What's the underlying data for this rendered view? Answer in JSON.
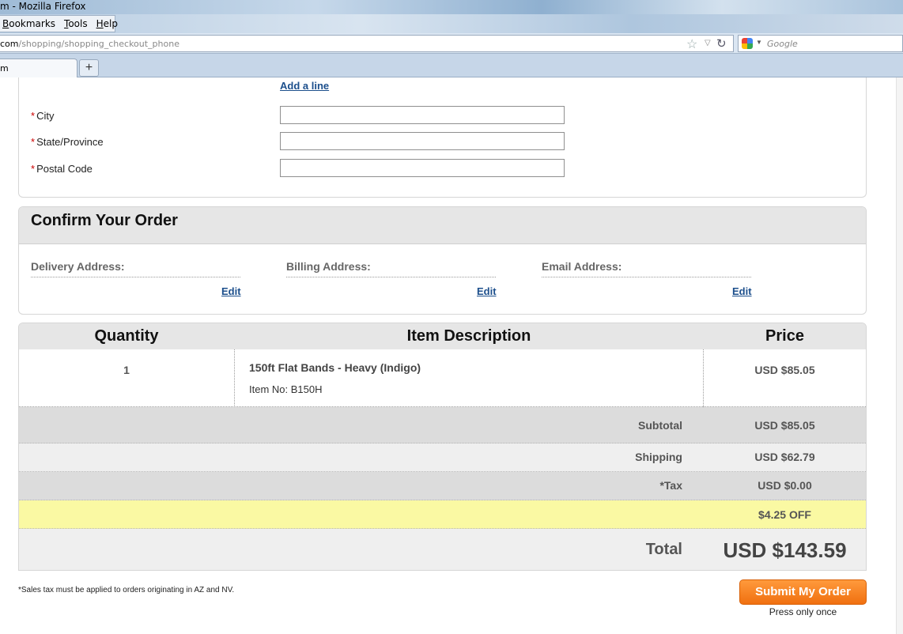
{
  "window": {
    "title": "m - Mozilla Firefox"
  },
  "menu": [
    {
      "label": "Bookmarks",
      "u": "B",
      "rest": "ookmarks"
    },
    {
      "label": "Tools",
      "u": "T",
      "rest": "ools"
    },
    {
      "label": "Help",
      "u": "H",
      "rest": "elp"
    }
  ],
  "address_bar": {
    "domain": "com",
    "path": "/shopping/shopping_checkout_phone"
  },
  "search_bar": {
    "placeholder": "Google"
  },
  "tab": {
    "label": "m",
    "new_tab_label": "+"
  },
  "form": {
    "add_line": "Add a line",
    "required_mark": "*",
    "fields": [
      {
        "label": "City",
        "value": ""
      },
      {
        "label": "State/Province",
        "value": ""
      },
      {
        "label": "Postal Code",
        "value": ""
      }
    ]
  },
  "confirm": {
    "title": "Confirm Your Order",
    "columns": [
      {
        "label": "Delivery Address:",
        "edit": "Edit"
      },
      {
        "label": "Billing Address:",
        "edit": "Edit"
      },
      {
        "label": "Email Address:",
        "edit": "Edit"
      }
    ]
  },
  "order": {
    "headers": {
      "quantity": "Quantity",
      "description": "Item Description",
      "price": "Price"
    },
    "items": [
      {
        "quantity": "1",
        "name": "150ft Flat Bands - Heavy (Indigo)",
        "item_no": "Item No: B150H",
        "price": "USD $85.05"
      }
    ],
    "subtotal": {
      "label": "Subtotal",
      "value": "USD $85.05"
    },
    "shipping": {
      "label": "Shipping",
      "value": "USD $62.79"
    },
    "tax": {
      "label": "*Tax",
      "value": "USD $0.00"
    },
    "discount": {
      "value": "$4.25 OFF"
    },
    "total": {
      "label": "Total",
      "value": "USD $143.59"
    }
  },
  "footer": {
    "tax_note": "*Sales tax must be applied to orders originating in AZ and NV.",
    "submit_label": "Submit My Order",
    "submit_note": "Press only once"
  },
  "colors": {
    "link": "#1c4f8c",
    "submit_button": "#f07010",
    "discount_row": "#faf9a3",
    "required": "#cc0000"
  }
}
